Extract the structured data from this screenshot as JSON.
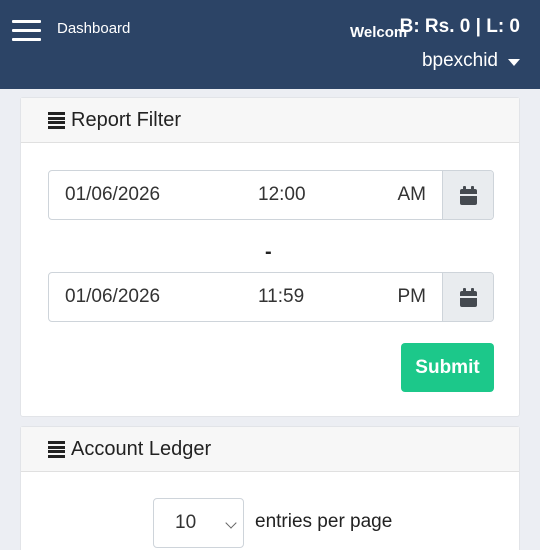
{
  "header": {
    "brand": "Dashboard",
    "welcome": "Welcome",
    "balance": "B: Rs. 0 | L: 0",
    "username": "bpexchid"
  },
  "report_filter": {
    "title": "Report Filter",
    "from": {
      "date": "01/06/2026",
      "time": "12:00",
      "ampm": "AM"
    },
    "separator": "-",
    "to": {
      "date": "01/06/2026",
      "time": "11:59",
      "ampm": "PM"
    },
    "submit_label": "Submit"
  },
  "account_ledger": {
    "title": "Account Ledger",
    "entries_value": "10",
    "entries_label": "entries per page"
  },
  "colors": {
    "header_bg": "#2c4466",
    "submit_bg": "#1cc88a",
    "page_bg": "#eceef3"
  }
}
